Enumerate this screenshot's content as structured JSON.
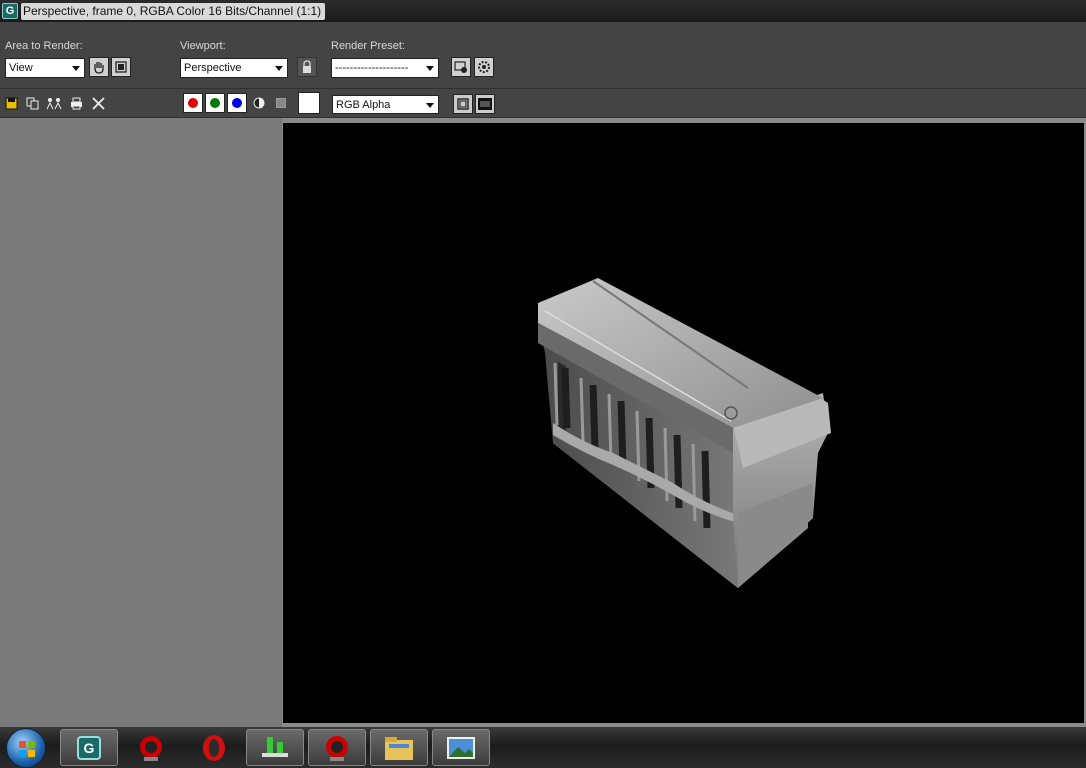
{
  "window": {
    "title": "Perspective, frame 0, RGBA Color 16 Bits/Channel (1:1)",
    "app_icon": "3ds-max-icon",
    "app_icon_glyph": "G"
  },
  "toolbar1": {
    "area_label": "Area to Render:",
    "area_value": "View",
    "viewport_label": "Viewport:",
    "viewport_value": "Perspective",
    "preset_label": "Render Preset:",
    "preset_value": "--------------------"
  },
  "toolbar2": {
    "channel_value": "RGB Alpha",
    "colors": {
      "red": "#e00000",
      "green": "#007a00",
      "blue": "#0000e0"
    }
  },
  "taskbar": {
    "items": [
      {
        "name": "3ds-max-task",
        "glyph": "G"
      },
      {
        "name": "red-app-task-1",
        "glyph": ""
      },
      {
        "name": "opera-task",
        "glyph": "O"
      },
      {
        "name": "green-app-task",
        "glyph": ""
      },
      {
        "name": "red-app-task-2",
        "glyph": ""
      },
      {
        "name": "file-explorer-task",
        "glyph": ""
      },
      {
        "name": "image-viewer-task",
        "glyph": ""
      }
    ]
  }
}
